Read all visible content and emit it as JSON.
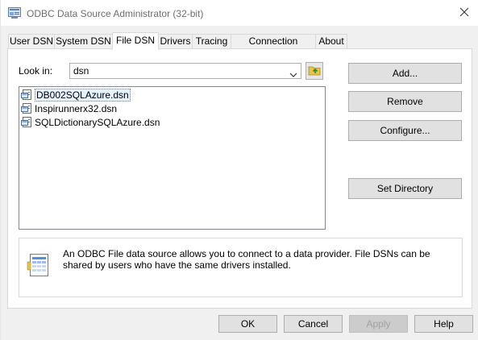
{
  "window": {
    "title": "ODBC Data Source Administrator (32-bit)"
  },
  "tabs": [
    {
      "label": "User DSN",
      "active": false
    },
    {
      "label": "System DSN",
      "active": false
    },
    {
      "label": "File DSN",
      "active": true
    },
    {
      "label": "Drivers",
      "active": false
    },
    {
      "label": "Tracing",
      "active": false
    },
    {
      "label": "Connection Pooling",
      "active": false
    },
    {
      "label": "About",
      "active": false
    }
  ],
  "lookin": {
    "label": "Look in:",
    "value": "dsn"
  },
  "files": [
    {
      "name": "DB002SQLAzure.dsn",
      "selected": true
    },
    {
      "name": "Inspirunnerx32.dsn",
      "selected": false
    },
    {
      "name": "SQLDictionarySQLAzure.dsn",
      "selected": false
    }
  ],
  "side_buttons": {
    "add": "Add...",
    "remove": "Remove",
    "configure": "Configure...",
    "set_directory": "Set Directory"
  },
  "description": "An ODBC File data source allows you to connect to a data provider.  File DSNs can be shared by users who have the same drivers installed.",
  "bottom_buttons": {
    "ok": "OK",
    "cancel": "Cancel",
    "apply": "Apply",
    "help": "Help"
  },
  "icons": {
    "title": "odbc-admin-icon",
    "close": "close-icon",
    "dropdown": "chevron-down-icon",
    "up_folder": "up-folder-icon",
    "file": "dsn-file-icon",
    "description": "data-source-icon"
  }
}
